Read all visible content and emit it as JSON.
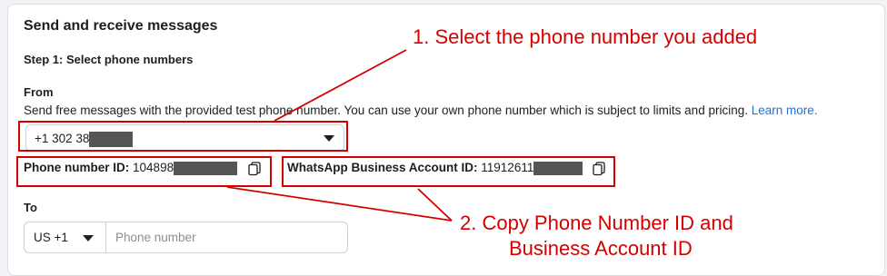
{
  "section": {
    "title": "Send and receive messages",
    "step": "Step 1: Select phone numbers"
  },
  "from": {
    "label": "From",
    "description": "Send free messages with the provided test phone number. You can use your own phone number which is subject to limits and pricing.",
    "learn_more": "Learn more.",
    "selected_number": "+1 302 38"
  },
  "ids": {
    "phone_label": "Phone number ID:",
    "phone_value": "104898",
    "waba_label": "WhatsApp Business Account ID:",
    "waba_value": "11912611"
  },
  "to": {
    "label": "To",
    "country_code": "US +1",
    "phone_placeholder": "Phone number"
  },
  "annotations": {
    "step1": "1. Select the phone number you added",
    "step2_line1": "2. Copy Phone Number ID and",
    "step2_line2": "Business Account ID"
  },
  "colors": {
    "annotation": "#d40000",
    "link": "#216fdb"
  }
}
